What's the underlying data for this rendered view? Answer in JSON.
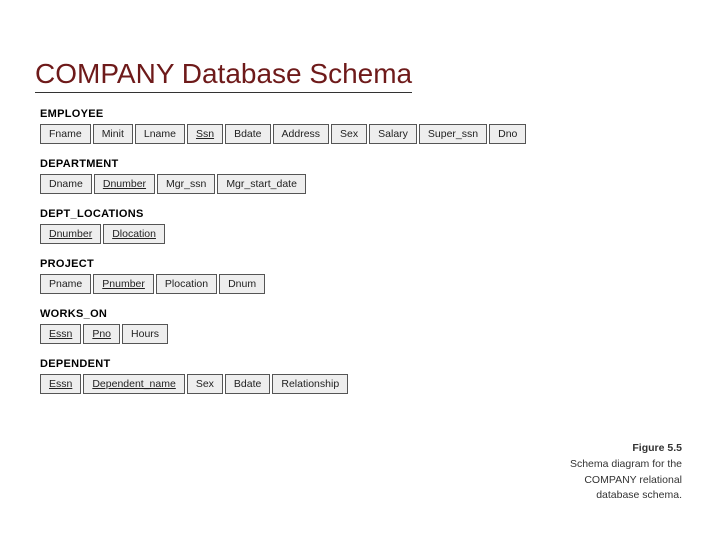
{
  "title": "COMPANY Database Schema",
  "tables": [
    {
      "name": "EMPLOYEE",
      "attrs": [
        {
          "label": "Fname",
          "key": false
        },
        {
          "label": "Minit",
          "key": false
        },
        {
          "label": "Lname",
          "key": false
        },
        {
          "label": "Ssn",
          "key": true
        },
        {
          "label": "Bdate",
          "key": false
        },
        {
          "label": "Address",
          "key": false
        },
        {
          "label": "Sex",
          "key": false
        },
        {
          "label": "Salary",
          "key": false
        },
        {
          "label": "Super_ssn",
          "key": false
        },
        {
          "label": "Dno",
          "key": false
        }
      ]
    },
    {
      "name": "DEPARTMENT",
      "attrs": [
        {
          "label": "Dname",
          "key": false
        },
        {
          "label": "Dnumber",
          "key": true
        },
        {
          "label": "Mgr_ssn",
          "key": false
        },
        {
          "label": "Mgr_start_date",
          "key": false
        }
      ]
    },
    {
      "name": "DEPT_LOCATIONS",
      "attrs": [
        {
          "label": "Dnumber",
          "key": true
        },
        {
          "label": "Dlocation",
          "key": true
        }
      ]
    },
    {
      "name": "PROJECT",
      "attrs": [
        {
          "label": "Pname",
          "key": false
        },
        {
          "label": "Pnumber",
          "key": true
        },
        {
          "label": "Plocation",
          "key": false
        },
        {
          "label": "Dnum",
          "key": false
        }
      ]
    },
    {
      "name": "WORKS_ON",
      "attrs": [
        {
          "label": "Essn",
          "key": true
        },
        {
          "label": "Pno",
          "key": true
        },
        {
          "label": "Hours",
          "key": false
        }
      ]
    },
    {
      "name": "DEPENDENT",
      "attrs": [
        {
          "label": "Essn",
          "key": true
        },
        {
          "label": "Dependent_name",
          "key": true
        },
        {
          "label": "Sex",
          "key": false
        },
        {
          "label": "Bdate",
          "key": false
        },
        {
          "label": "Relationship",
          "key": false
        }
      ]
    }
  ],
  "caption": {
    "title": "Figure 5.5",
    "text": "Schema diagram for the COMPANY relational database schema."
  }
}
